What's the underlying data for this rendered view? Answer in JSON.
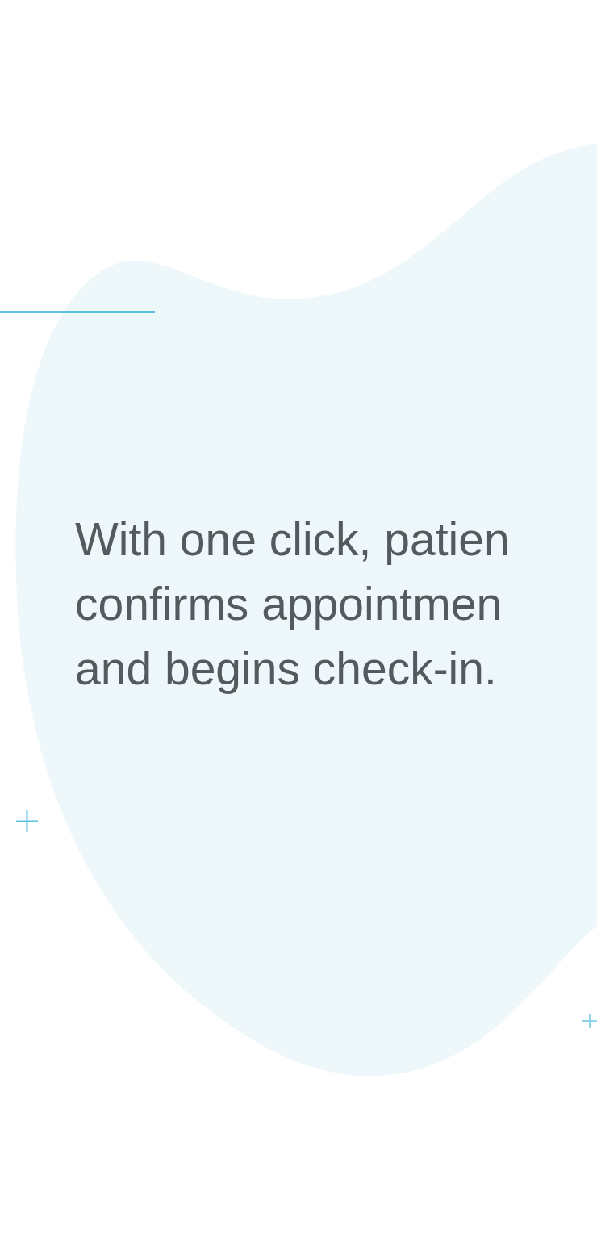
{
  "intro": {
    "lines": [
      "With one click, patien",
      "confirms appointmen",
      "and begins check-in."
    ]
  }
}
